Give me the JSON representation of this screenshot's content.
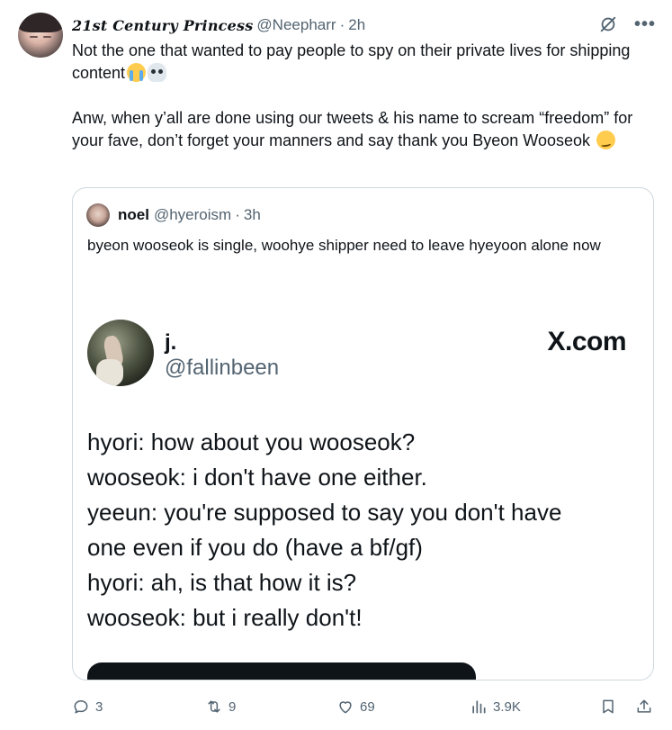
{
  "author": {
    "display_name": "21st Century Princess",
    "handle": "@Neepharr",
    "separator": "·",
    "time": "2h"
  },
  "tweet": {
    "paragraph_1": "Not the one that wanted to pay people to spy on their private lives for shipping content",
    "paragraph_2": "Anw, when y’all are done using our tweets & his name to scream “freedom” for your fave, don’t forget your manners and say thank you Byeon Wooseok"
  },
  "quote": {
    "display_name": "noel",
    "handle": "@hyeroism",
    "separator": "·",
    "time": "3h",
    "text": "byeon wooseok is single, woohye shipper need to leave hyeyoon alone now"
  },
  "media": {
    "name": "j.",
    "handle": "@fallinbeen",
    "brand": "X.com",
    "lines": [
      "hyori: how about you wooseok?",
      "wooseok: i don't have one either.",
      "yeeun: you're supposed to say you don't have",
      "one even if you do (have a bf/gf)",
      "hyori: ah, is that how it is?",
      "wooseok: but i really don't!"
    ]
  },
  "actions": {
    "replies": "3",
    "reposts": "9",
    "likes": "69",
    "views": "3.9K"
  },
  "colors": {
    "text": "#0f1419",
    "secondary": "#536471",
    "border": "#cfd9de"
  }
}
